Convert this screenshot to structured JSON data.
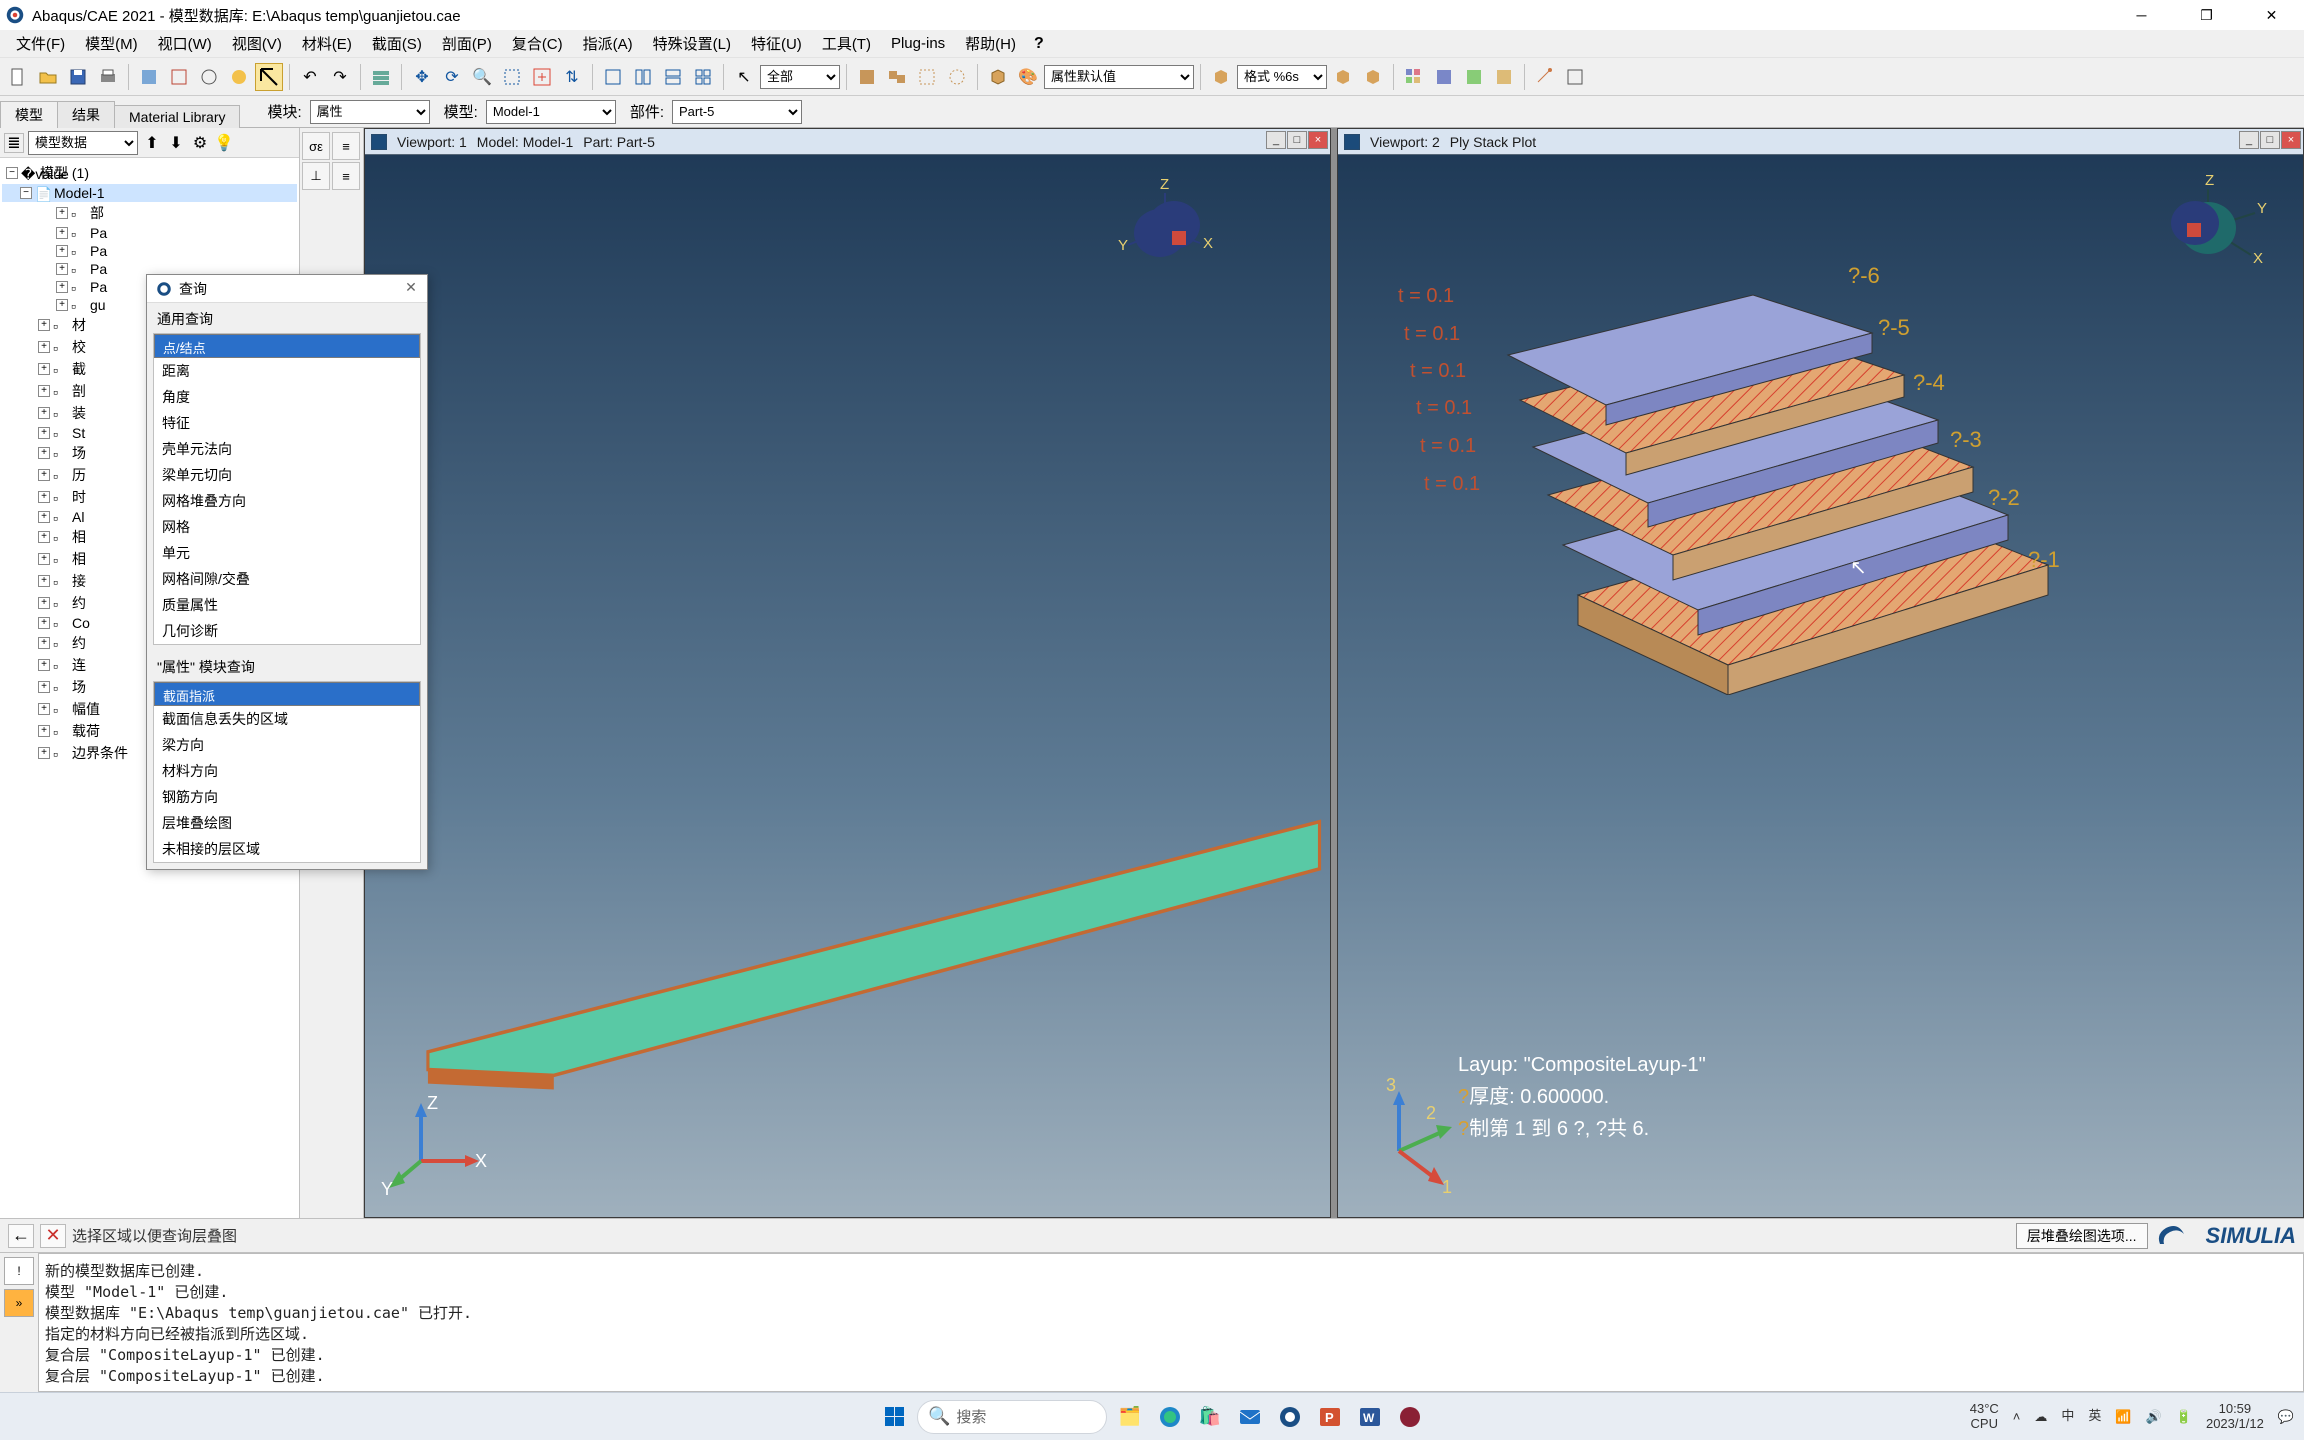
{
  "titlebar": {
    "app": "Abaqus/CAE 2021",
    "sep": " - ",
    "doc_label": "模型数据库: ",
    "doc_path": "E:\\Abaqus temp\\guanjietou.cae"
  },
  "menus": [
    "文件(F)",
    "模型(M)",
    "视口(W)",
    "视图(V)",
    "材料(E)",
    "截面(S)",
    "剖面(P)",
    "复合(C)",
    "指派(A)",
    "特殊设置(L)",
    "特征(U)",
    "工具(T)",
    "Plug-ins",
    "帮助(H)"
  ],
  "context": {
    "tabs": [
      "模型",
      "结果",
      "Material Library"
    ],
    "module_label": "模块:",
    "module_value": "属性",
    "model_label": "模型:",
    "model_value": "Model-1",
    "part_label": "部件:",
    "part_value": "Part-5"
  },
  "toolbar2": {
    "all": "全部",
    "attrdefault": "属性默认值",
    "fmt": "格式 %6s"
  },
  "tree_toolbar_label": "模型数据",
  "tree": {
    "root": "模型 (1)",
    "model": "Model-1",
    "items": [
      {
        "icon": "folder",
        "label": "部"
      },
      {
        "icon": "part",
        "label": "Pa"
      },
      {
        "icon": "part",
        "label": "Pa"
      },
      {
        "icon": "part",
        "label": "Pa"
      },
      {
        "icon": "part",
        "label": "Pa"
      },
      {
        "icon": "part",
        "label": "gu"
      },
      {
        "icon": "mat",
        "label": "材"
      },
      {
        "icon": "cal",
        "label": "校"
      },
      {
        "icon": "sec",
        "label": "截"
      },
      {
        "icon": "prof",
        "label": "剖"
      },
      {
        "icon": "asm",
        "label": "装"
      },
      {
        "icon": "step",
        "label": "St"
      },
      {
        "icon": "field",
        "label": "场"
      },
      {
        "icon": "hist",
        "label": "历"
      },
      {
        "icon": "time",
        "label": "时"
      },
      {
        "icon": "ale",
        "label": "Al"
      },
      {
        "icon": "int",
        "label": "相"
      },
      {
        "icon": "intp",
        "label": "相"
      },
      {
        "icon": "cont",
        "label": "接"
      },
      {
        "icon": "cons",
        "label": "约"
      },
      {
        "icon": "conn",
        "label": "Co"
      },
      {
        "icon": "conn2",
        "label": "约"
      },
      {
        "icon": "link",
        "label": "连"
      },
      {
        "icon": "F",
        "label": "场"
      },
      {
        "icon": "amp",
        "label": "幅值"
      },
      {
        "icon": "load",
        "label": "载荷"
      },
      {
        "icon": "bc",
        "label": "边界条件"
      }
    ]
  },
  "dialog": {
    "title": "查询",
    "section1": "通用查询",
    "list1": [
      "点/结点",
      "距离",
      "角度",
      "特征",
      "壳单元法向",
      "梁单元切向",
      "网格堆叠方向",
      "网格",
      "单元",
      "网格间隙/交叠",
      "质量属性",
      "几何诊断"
    ],
    "sel1": 0,
    "section2": "\"属性\" 模块查询",
    "list2": [
      "截面指派",
      "截面信息丢失的区域",
      "梁方向",
      "材料方向",
      "钢筋方向",
      "层堆叠绘图",
      "未相接的层区域"
    ],
    "sel2": 0
  },
  "viewport1": {
    "vp": "Viewport: 1",
    "model": "Model: Model-1",
    "part": "Part: Part-5"
  },
  "viewport2": {
    "vp": "Viewport: 2",
    "title": "Ply Stack Plot",
    "t_labels": [
      "t = 0.1",
      "t = 0.1",
      "t = 0.1",
      "t = 0.1",
      "t = 0.1",
      "t = 0.1"
    ],
    "ply_labels": [
      "?-1",
      "?-2",
      "?-3",
      "?-4",
      "?-5",
      "?-6"
    ],
    "info1": "Layup: \"CompositeLayup-1\"",
    "info2_pre": "?",
    "info2": "厚度: 0.600000.",
    "info3_pre": "?",
    "info3": "制第 1 到 6 ?, ?共 6."
  },
  "prompt": {
    "text": "选择区域以便查询层叠图",
    "rightbtn": "层堆叠绘图选项...",
    "brand": "SIMULIA"
  },
  "messages": "新的模型数据库已创建.\n模型 \"Model-1\" 已创建.\n模型数据库 \"E:\\Abaqus temp\\guanjietou.cae\" 已打开.\n指定的材料方向已经被指派到所选区域.\n复合层 \"CompositeLayup-1\" 已创建.\n复合层 \"CompositeLayup-1\" 已创建.",
  "taskbar": {
    "search_placeholder": "搜索",
    "temp": "43°C",
    "cpu": "CPU",
    "ime1": "中",
    "ime2": "英",
    "time": "10:59",
    "date": "2023/1/12"
  }
}
